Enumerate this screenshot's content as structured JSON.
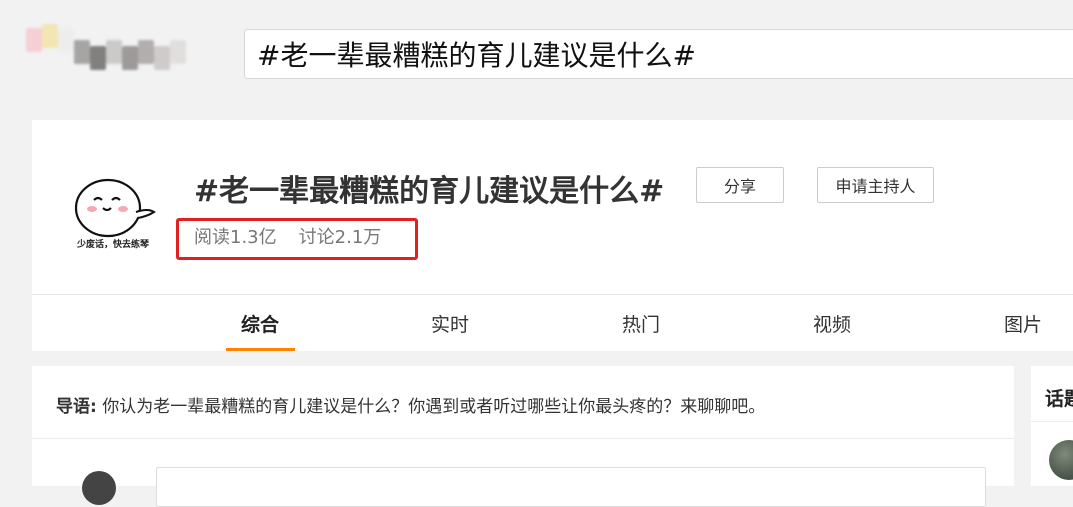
{
  "header": {
    "search_value": "#老一辈最糟糕的育儿建议是什么#"
  },
  "topic": {
    "avatar_caption": "少废话，快去练琴",
    "title": "#老一辈最糟糕的育儿建议是什么#",
    "stats": {
      "reads": "阅读1.3亿",
      "discussions": "讨论2.1万"
    },
    "share_label": "分享",
    "apply_host_label": "申请主持人",
    "highlight_color": "#e32020"
  },
  "tabs": [
    {
      "label": "综合",
      "active": true
    },
    {
      "label": "实时",
      "active": false
    },
    {
      "label": "热门",
      "active": false
    },
    {
      "label": "视频",
      "active": false
    },
    {
      "label": "图片",
      "active": false
    }
  ],
  "accent_color": "#ff8200",
  "intro": {
    "label": "导语:",
    "text": "你认为老一辈最糟糕的育儿建议是什么？你遇到或者听过哪些让你最头疼的？来聊聊吧。"
  },
  "sidebar": {
    "title": "话题"
  }
}
